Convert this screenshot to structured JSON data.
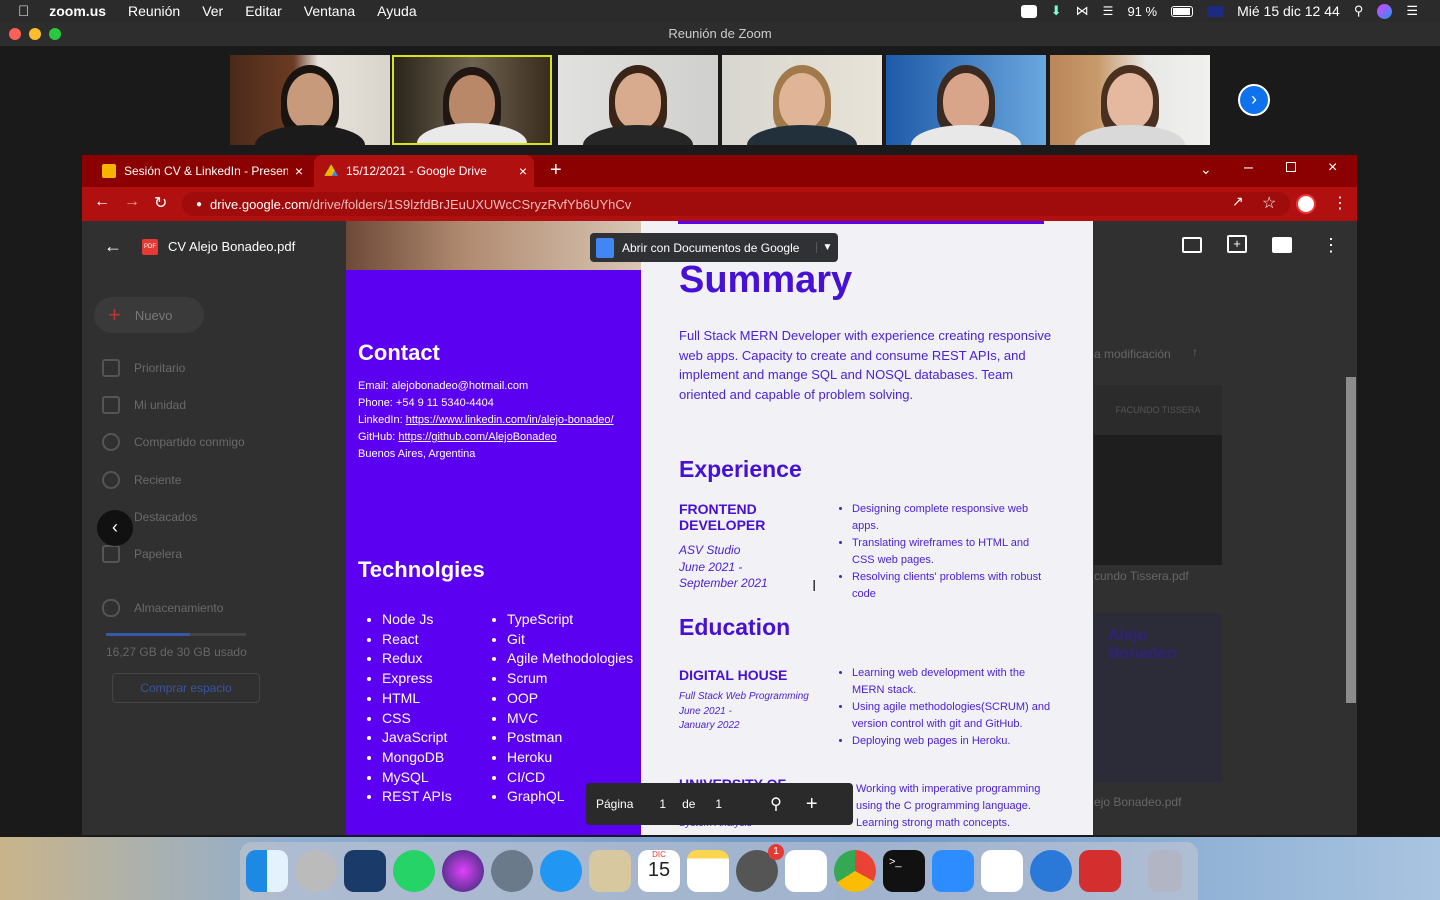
{
  "menubar": {
    "app": "zoom.us",
    "items": [
      "Reunión",
      "Ver",
      "Editar",
      "Ventana",
      "Ayuda"
    ],
    "battery": "91 %",
    "clock": "Mié 15 dic  12 44"
  },
  "zoom": {
    "title": "Reunión de Zoom"
  },
  "chrome": {
    "tab1": "Sesión CV & LinkedIn - Presentac",
    "tab2": "15/12/2021 - Google Drive",
    "url_host": "drive.google.com",
    "url_path": "/drive/folders/1S9lzfdBrJEuUXUWcCSryzRvfYb6UYhCv"
  },
  "viewer": {
    "filename": "CV Alejo Bonadeo.pdf",
    "open_with": "Abrir con Documentos de Google",
    "page_label": "Página",
    "page_num": "1",
    "de": "de",
    "total": "1"
  },
  "drive": {
    "new": "Nuevo",
    "prioritario": "Prioritario",
    "mi_unidad": "Mi unidad",
    "compartido": "Compartido conmigo",
    "reciente": "Reciente",
    "destacados": "Destacados",
    "papelera": "Papelera",
    "almacenamiento": "Almacenamiento",
    "uso": "16,27 GB de 30 GB usado",
    "comprar": "Comprar espacio",
    "sort": "a modificación",
    "file1": "cundo Tissera.pdf",
    "file2": "ejo Bonadeo.pdf",
    "thumb_name": "FACUNDO TISSERA",
    "thumb_name2": "Alejo Bonadeo"
  },
  "cv": {
    "contact_h": "Contact",
    "email": "Email: alejobonadeo@hotmail.com",
    "phone": "Phone: +54 9 11 5340-4404",
    "linkedin_l": "LinkedIn: ",
    "linkedin": "https://www.linkedin.com/in/alejo-bonadeo/",
    "github_l": "GitHub: ",
    "github": "https://github.com/AlejoBonadeo",
    "location": "Buenos Aires, Argentina",
    "tech_h": "Technolgies",
    "tech1": [
      "Node Js",
      "React",
      "Redux",
      "Express",
      "HTML",
      "CSS",
      "JavaScript",
      "MongoDB",
      "MySQL",
      "REST APIs"
    ],
    "tech2": [
      "TypeScript",
      "Git",
      "Agile Methodologies",
      "Scrum",
      "OOP",
      "MVC",
      "Postman",
      "Heroku",
      "CI/CD",
      "GraphQL"
    ],
    "summary_h": "Summary",
    "summary": "Full Stack MERN Developer with experience creating responsive web apps. Capacity to create and consume REST APIs, and implement and mange SQL and NOSQL databases. Team oriented and capable of problem solving.",
    "exp_h": "Experience",
    "job_title": "FRONTEND DEVELOPER",
    "job_company": "ASV Studio",
    "job_dates": "June 2021 - September 2021",
    "job_bullets": [
      "Designing complete responsive web apps.",
      "Translating wireframes to HTML and CSS web pages.",
      "Resolving clients' problems with robust code"
    ],
    "edu_h": "Education",
    "edu1_title": "DIGITAL HOUSE",
    "edu1_sub": "Full Stack Web Programming",
    "edu1_dates": "June 2021 - January 2022",
    "edu1_bullets": [
      "Learning web development with the MERN stack.",
      "Using agile methodologies(SCRUM) and version control with git and GitHub.",
      "Deploying web pages in Heroku."
    ],
    "edu2_title": "UNIVERSITY OF BUENOS AIRES",
    "edu2_sub": "System Analysis",
    "edu2_bullets": [
      "Working with imperative programming using the C programming language.",
      "Learning strong math concepts."
    ]
  },
  "dock": {
    "calendar_month": "DIC",
    "calendar_day": "15",
    "badge": "1"
  }
}
